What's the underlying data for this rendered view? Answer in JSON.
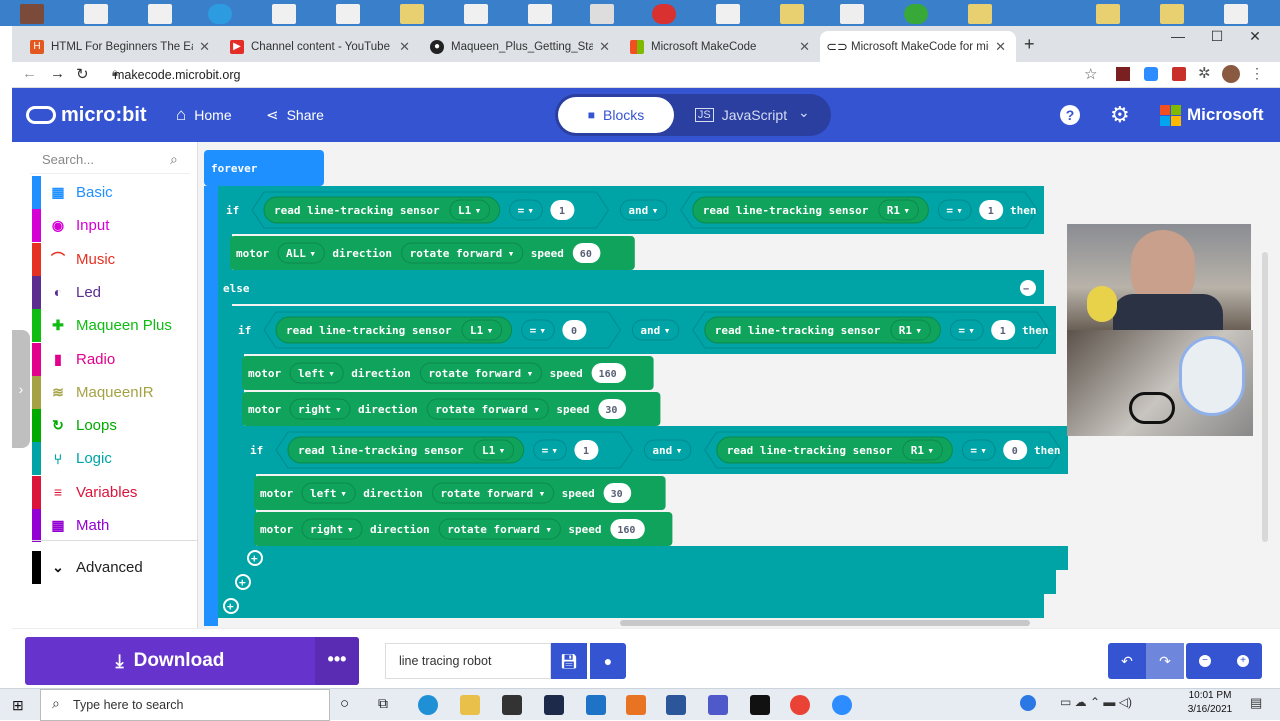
{
  "browser": {
    "tabs": [
      {
        "title": "HTML For Beginners The Easy W",
        "icon": "html-favicon",
        "color": "#e2581f"
      },
      {
        "title": "Channel content - YouTube Studi",
        "icon": "youtube-favicon",
        "color": "#e52d27"
      },
      {
        "title": "Maqueen_Plus_Getting_Started_T",
        "icon": "github-favicon",
        "color": "#222222"
      },
      {
        "title": "Microsoft MakeCode",
        "icon": "microsoft-favicon",
        "color": "#f25022"
      },
      {
        "title": "Microsoft MakeCode for micro:bi",
        "icon": "makecode-favicon",
        "color": "#222222",
        "active": true
      }
    ],
    "new_tab": "+",
    "url": "makecode.microbit.org"
  },
  "header": {
    "logo": "micro:bit",
    "home": "Home",
    "share": "Share",
    "blocks": "Blocks",
    "javascript": "JavaScript",
    "microsoft": "Microsoft",
    "brand_color": "#3454d1"
  },
  "toolbox": {
    "search_placeholder": "Search...",
    "categories": [
      {
        "label": "Basic",
        "color": "#1e90ff",
        "icon": "grid-icon"
      },
      {
        "label": "Input",
        "color": "#d400d4",
        "icon": "input-icon"
      },
      {
        "label": "Music",
        "color": "#e63022",
        "icon": "headphones-icon"
      },
      {
        "label": "Led",
        "color": "#5c2d91",
        "icon": "toggle-icon"
      },
      {
        "label": "Maqueen Plus",
        "color": "#0fbc11",
        "icon": "plus-icon"
      },
      {
        "label": "Radio",
        "color": "#e3008c",
        "icon": "signal-icon"
      },
      {
        "label": "MaqueenIR",
        "color": "#a5a244",
        "icon": "wifi-icon"
      },
      {
        "label": "Loops",
        "color": "#00aa00",
        "icon": "loop-icon"
      },
      {
        "label": "Logic",
        "color": "#00a4a6",
        "icon": "logic-icon"
      },
      {
        "label": "Variables",
        "color": "#dc143c",
        "icon": "lines-icon"
      },
      {
        "label": "Math",
        "color": "#9400d3",
        "icon": "calculator-icon"
      }
    ],
    "advanced": "Advanced"
  },
  "workspace": {
    "forever": "forever",
    "kw_if": "if",
    "kw_else": "else",
    "kw_then": "then",
    "kw_and": "and",
    "eq": "=",
    "read_sensor": "read line-tracking sensor",
    "motor": "motor",
    "direction": "direction",
    "speed": "speed",
    "rotate_forward": "rotate forward",
    "cond1": {
      "left_sensor": "L1",
      "left_val": "1",
      "right_sensor": "R1",
      "right_val": "1"
    },
    "motor1": {
      "which": "ALL",
      "speed": "60"
    },
    "cond2": {
      "left_sensor": "L1",
      "left_val": "0",
      "right_sensor": "R1",
      "right_val": "1"
    },
    "motor2": {
      "which": "left",
      "speed": "160"
    },
    "motor3": {
      "which": "right",
      "speed": "30"
    },
    "cond3": {
      "left_sensor": "L1",
      "left_val": "1",
      "right_sensor": "R1",
      "right_val": "0"
    },
    "motor4": {
      "which": "left",
      "speed": "30"
    },
    "motor5": {
      "which": "right",
      "speed": "160"
    },
    "colors": {
      "loop": "#1e90ff",
      "logic": "#00a4a6",
      "maqueen": "#0fa35b",
      "maqueen_dark": "#0b8a4b"
    }
  },
  "footer": {
    "download": "Download",
    "more": "•••",
    "project_name": "line tracing robot",
    "download_color": "#6633cc"
  },
  "taskbar": {
    "search_placeholder": "Type here to search",
    "time": "10:01 PM",
    "date": "3/16/2021"
  }
}
